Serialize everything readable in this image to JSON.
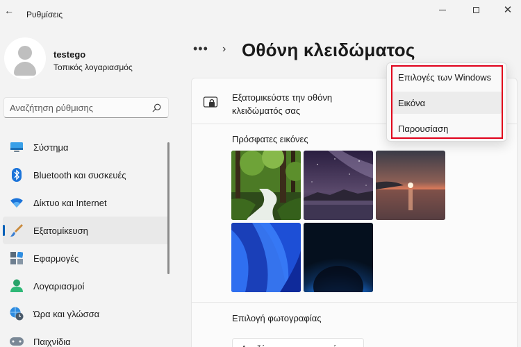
{
  "window": {
    "title": "Ρυθμίσεις",
    "back_glyph": "←",
    "close_glyph": "✕"
  },
  "profile": {
    "name": "testego",
    "account_type": "Τοπικός λογαριασμός"
  },
  "search": {
    "placeholder": "Αναζήτηση ρύθμισης"
  },
  "sidebar": {
    "items": [
      {
        "label": "Σύστημα",
        "icon": "monitor-icon"
      },
      {
        "label": "Bluetooth και συσκευές",
        "icon": "bluetooth-icon"
      },
      {
        "label": "Δίκτυο και Internet",
        "icon": "wifi-icon"
      },
      {
        "label": "Εξατομίκευση",
        "icon": "brush-icon",
        "active": true
      },
      {
        "label": "Εφαρμογές",
        "icon": "apps-icon"
      },
      {
        "label": "Λογαριασμοί",
        "icon": "person-icon"
      },
      {
        "label": "Ώρα και γλώσσα",
        "icon": "globe-clock-icon"
      },
      {
        "label": "Παιχνίδια",
        "icon": "gamepad-icon"
      }
    ]
  },
  "breadcrumb": {
    "more": "•••",
    "separator": "›",
    "title": "Οθόνη κλειδώματος"
  },
  "panel": {
    "personalize_label": "Εξατομικεύστε την οθόνη κλειδώματός σας",
    "recent_images_title": "Πρόσφατες εικόνες",
    "choose_photo_label": "Επιλογή φωτογραφίας",
    "browse_button_label": "Αναζήτηση φωτογραφιών"
  },
  "dropdown": {
    "options": [
      "Επιλογές των Windows",
      "Εικόνα",
      "Παρουσίαση"
    ],
    "hovered": "Εικόνα"
  },
  "colors": {
    "accent": "#005fb8",
    "highlight_box": "#e0001a"
  }
}
